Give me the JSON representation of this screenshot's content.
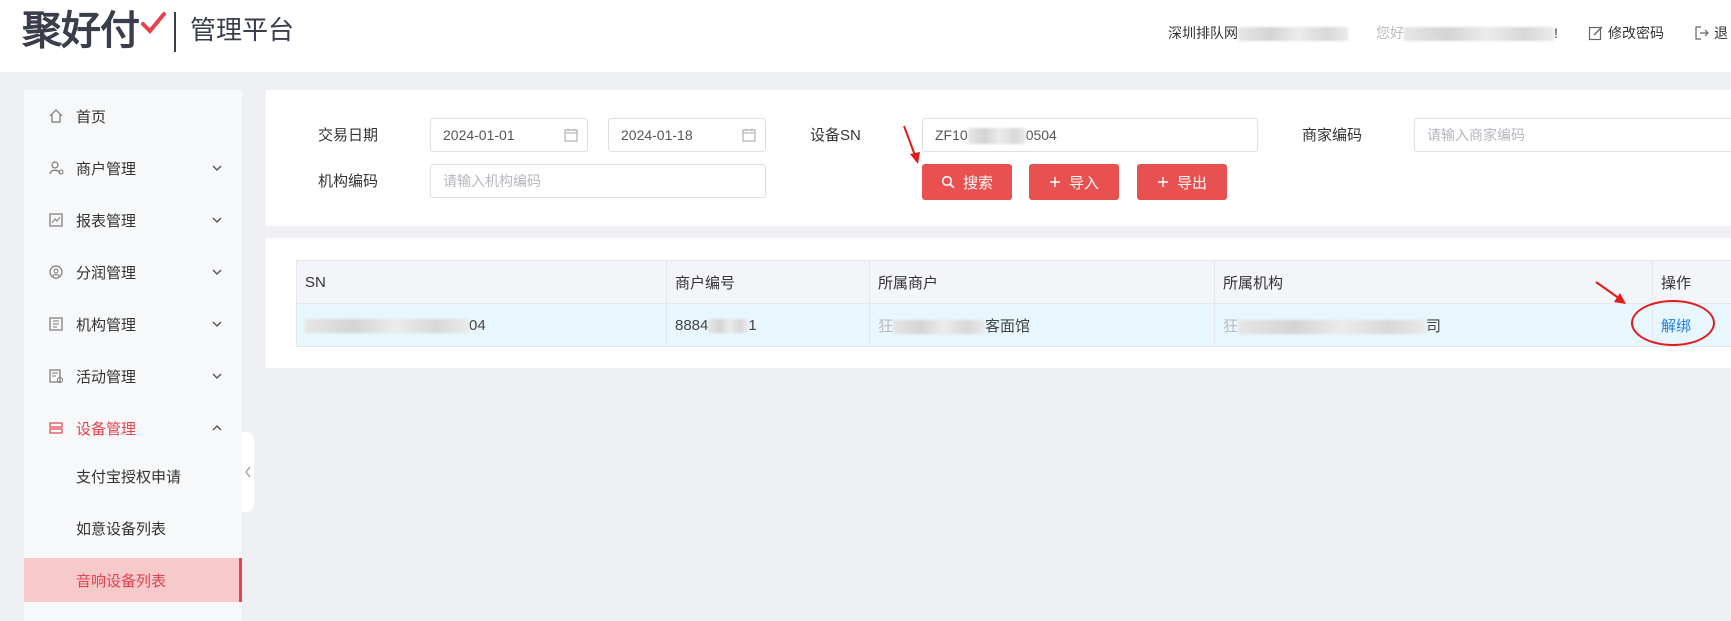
{
  "header": {
    "logo": "聚好付",
    "platform_title": "管理平台",
    "org_name_prefix": "深圳排队网",
    "greeting_prefix": "您好",
    "greeting_suffix": "!",
    "change_password": "修改密码",
    "logout": "退"
  },
  "sidebar": {
    "items": [
      {
        "label": "首页",
        "icon": "home-icon"
      },
      {
        "label": "商户管理",
        "icon": "merchant-icon"
      },
      {
        "label": "报表管理",
        "icon": "report-icon"
      },
      {
        "label": "分润管理",
        "icon": "profit-icon"
      },
      {
        "label": "机构管理",
        "icon": "org-icon"
      },
      {
        "label": "活动管理",
        "icon": "activity-icon"
      },
      {
        "label": "设备管理",
        "icon": "device-icon"
      }
    ],
    "sub_items": [
      {
        "label": "支付宝授权申请"
      },
      {
        "label": "如意设备列表"
      },
      {
        "label": "音响设备列表"
      }
    ]
  },
  "filters": {
    "trade_date_label": "交易日期",
    "date_start": "2024-01-01",
    "date_end": "2024-01-18",
    "device_sn_label": "设备SN",
    "device_sn_prefix": "ZF10",
    "device_sn_suffix": "0504",
    "merchant_code_label": "商家编码",
    "merchant_code_placeholder": "请输入商家编码",
    "org_code_label": "机构编码",
    "org_code_placeholder": "请输入机构编码"
  },
  "buttons": {
    "search": "搜索",
    "import": "导入",
    "export": "导出"
  },
  "table": {
    "columns": [
      "SN",
      "商户编号",
      "所属商户",
      "所属机构",
      "操作"
    ],
    "rows": [
      {
        "sn_suffix": "04",
        "merchant_no_prefix": "8884",
        "merchant_no_suffix": "1",
        "merchant_prefix": "狂",
        "merchant_suffix": "客面馆",
        "org_prefix": "狂",
        "org_suffix": "司",
        "action": "解绑"
      }
    ]
  },
  "colors": {
    "accent": "#e8514f",
    "link": "#1e7fe0",
    "annotation": "#e01b1b"
  }
}
